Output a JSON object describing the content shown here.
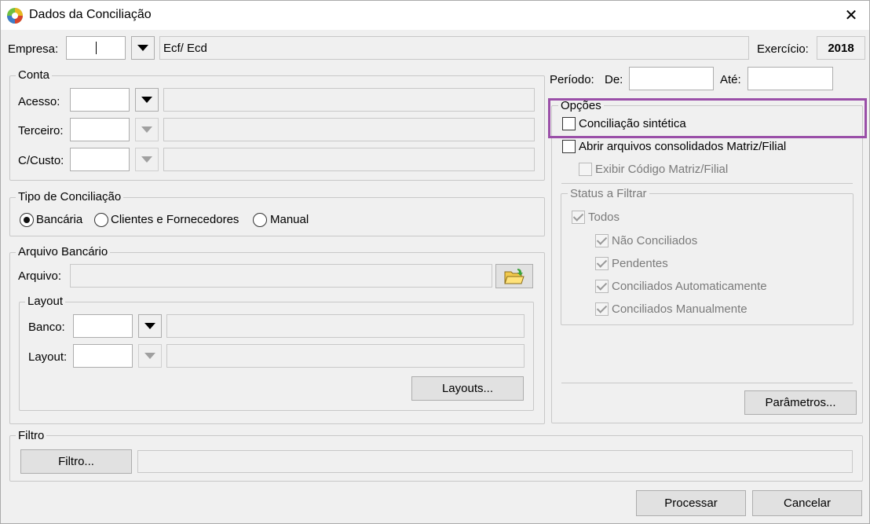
{
  "window": {
    "title": "Dados da Conciliação",
    "close_glyph": "✕"
  },
  "top": {
    "empresa_label": "Empresa:",
    "empresa_value": "",
    "empresa_desc": "Ecf/ Ecd",
    "exercicio_label": "Exercício:",
    "exercicio_value": "2018"
  },
  "conta": {
    "legend": "Conta",
    "acesso_label": "Acesso:",
    "terceiro_label": "Terceiro:",
    "ccusto_label": "C/Custo:"
  },
  "tipo": {
    "legend": "Tipo de Conciliação",
    "options": [
      "Bancária",
      "Clientes e Fornecedores",
      "Manual"
    ],
    "selected": "Bancária"
  },
  "arquivo": {
    "legend": "Arquivo Bancário",
    "arquivo_label": "Arquivo:",
    "layout_legend": "Layout",
    "banco_label": "Banco:",
    "layout_label": "Layout:",
    "layouts_button": "Layouts..."
  },
  "periodo": {
    "label": "Período:",
    "de_label": "De:",
    "ate_label": "Até:"
  },
  "opcoes": {
    "legend": "Opções",
    "sintetica": "Conciliação sintética",
    "abrir": "Abrir arquivos consolidados Matriz/Filial",
    "exibir": "Exibir Código Matriz/Filial"
  },
  "status": {
    "legend": "Status a Filtrar",
    "todos": "Todos",
    "items": [
      "Não Conciliados",
      "Pendentes",
      "Conciliados Automaticamente",
      "Conciliados Manualmente"
    ]
  },
  "parametros_button": "Parâmetros...",
  "filtro": {
    "legend": "Filtro",
    "button": "Filtro..."
  },
  "footer": {
    "processar": "Processar",
    "cancelar": "Cancelar"
  },
  "colors": {
    "highlight": "#9a4fa8"
  }
}
